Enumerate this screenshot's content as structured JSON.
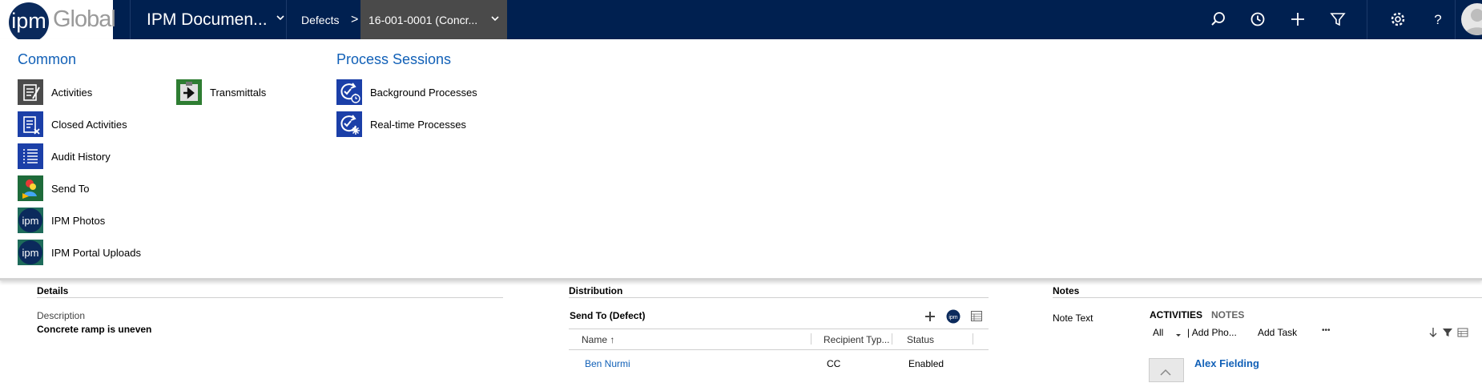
{
  "header": {
    "logo_mark": "ipm",
    "logo_word": "Global",
    "app_title": "IPM Documen...",
    "breadcrumb_entity": "Defects",
    "breadcrumb_sep": ">",
    "breadcrumb_record": "16-001-0001 (Concr...",
    "icons": [
      "search-icon",
      "history-icon",
      "plus-icon",
      "filter-icon",
      "gear-icon",
      "help-icon",
      "avatar"
    ]
  },
  "menu": {
    "common_title": "Common",
    "common_items": [
      {
        "label": "Activities",
        "icon": "activities-icon"
      },
      {
        "label": "Closed Activities",
        "icon": "closed-activities-icon"
      },
      {
        "label": "Audit History",
        "icon": "audit-history-icon"
      },
      {
        "label": "Send To",
        "icon": "send-to-icon"
      },
      {
        "label": "IPM Photos",
        "icon": "ipm-photos-icon"
      },
      {
        "label": "IPM Portal Uploads",
        "icon": "ipm-portal-uploads-icon"
      }
    ],
    "common_col2": [
      {
        "label": "Transmittals",
        "icon": "transmittals-icon"
      }
    ],
    "process_title": "Process Sessions",
    "process_items": [
      {
        "label": "Background Processes",
        "icon": "background-processes-icon"
      },
      {
        "label": "Real-time Processes",
        "icon": "realtime-processes-icon"
      }
    ]
  },
  "details": {
    "title": "Details",
    "description_label": "Description",
    "description_value": "Concrete ramp is uneven"
  },
  "distribution": {
    "title": "Distribution",
    "subgrid_title": "Send To (Defect)",
    "columns": [
      "Name ↑",
      "Recipient Typ...",
      "Status"
    ],
    "rows": [
      {
        "name": "Ben Nurmi",
        "recipient_type": "CC",
        "status": "Enabled"
      }
    ]
  },
  "notes": {
    "title": "Notes",
    "note_text_label": "Note Text",
    "tab_activities": "ACTIVITIES",
    "tab_notes": "NOTES",
    "filter_all": "All",
    "add_photo": "| Add Pho...",
    "add_task": "Add Task",
    "more": "•••",
    "activity_owner": "Alex Fielding"
  },
  "colors": {
    "nav_bg": "#002050",
    "accent_link": "#1160b7",
    "record_crumb_bg": "#4a4a4a"
  }
}
